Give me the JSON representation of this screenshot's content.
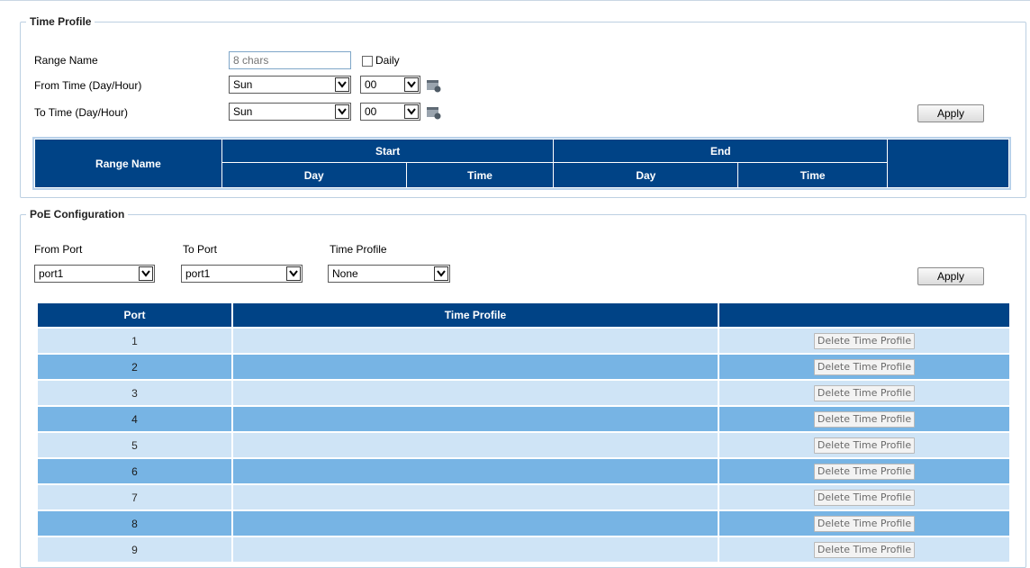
{
  "time_profile": {
    "title": "Time Profile",
    "range_name_label": "Range Name",
    "range_name_placeholder": "8 chars",
    "daily_label": "Daily",
    "from_label": "From Time (Day/Hour)",
    "to_label": "To Time (Day/Hour)",
    "from_day": "Sun",
    "from_hour": "00",
    "to_day": "Sun",
    "to_hour": "00",
    "apply_label": "Apply",
    "table": {
      "range_name": "Range Name",
      "start": "Start",
      "end": "End",
      "day": "Day",
      "time": "Time"
    }
  },
  "poe_config": {
    "title": "PoE Configuration",
    "from_port_label": "From Port",
    "to_port_label": "To Port",
    "time_profile_label": "Time Profile",
    "from_port_value": "port1",
    "to_port_value": "port1",
    "time_profile_value": "None",
    "apply_label": "Apply",
    "table": {
      "headers": [
        "Port",
        "Time Profile",
        ""
      ],
      "delete_label": "Delete Time Profile",
      "rows": [
        {
          "port": "1",
          "profile": ""
        },
        {
          "port": "2",
          "profile": ""
        },
        {
          "port": "3",
          "profile": ""
        },
        {
          "port": "4",
          "profile": ""
        },
        {
          "port": "5",
          "profile": ""
        },
        {
          "port": "6",
          "profile": ""
        },
        {
          "port": "7",
          "profile": ""
        },
        {
          "port": "8",
          "profile": ""
        },
        {
          "port": "9",
          "profile": ""
        }
      ]
    }
  },
  "colors": {
    "header_blue": "#004386",
    "row_light": "#cfe4f6",
    "row_dark": "#77b4e4"
  }
}
